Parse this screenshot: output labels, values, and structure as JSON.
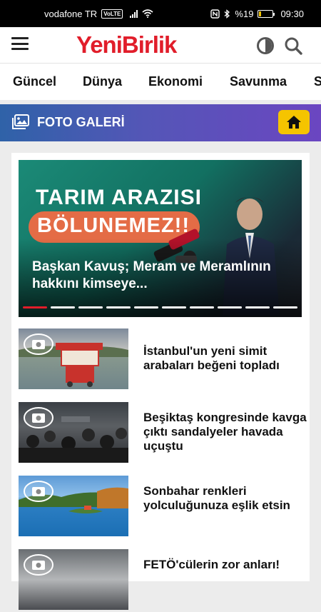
{
  "status_bar": {
    "carrier": "vodafone TR",
    "volte": "VoLTE",
    "battery": "%19",
    "battery_level": 0.19,
    "time": "09:30"
  },
  "header": {
    "logo": "YeniBirlik",
    "icons": [
      "menu-icon",
      "contrast-icon",
      "search-icon"
    ]
  },
  "nav": {
    "items": [
      {
        "label": "Güncel"
      },
      {
        "label": "Dünya"
      },
      {
        "label": "Ekonomi"
      },
      {
        "label": "Savunma"
      },
      {
        "label": "S"
      }
    ]
  },
  "section": {
    "title": "FOTO GALERİ",
    "home_icon": "home-icon"
  },
  "featured": {
    "banner_line1": "TARIM ARAZISI",
    "banner_line2": "BÖLUNEMEZ!!",
    "title": "Başkan Kavuş; Meram ve Meramlının hakkını kimseye...",
    "slide_count": 10,
    "active_slide": 1
  },
  "news": [
    {
      "title": "İstanbul'un yeni simit arabaları beğeni topladı"
    },
    {
      "title": "Beşiktaş kongresinde kavga çıktı sandalyeler havada uçuştu"
    },
    {
      "title": "Sonbahar renkleri yolculuğunuza eşlik etsin"
    },
    {
      "title": "FETÖ'cülerin zor anları!"
    }
  ],
  "colors": {
    "brand": "#e11d2a",
    "section_gradient_start": "#2f62a8",
    "section_gradient_end": "#6b46c1",
    "home_button": "#f5c400"
  }
}
